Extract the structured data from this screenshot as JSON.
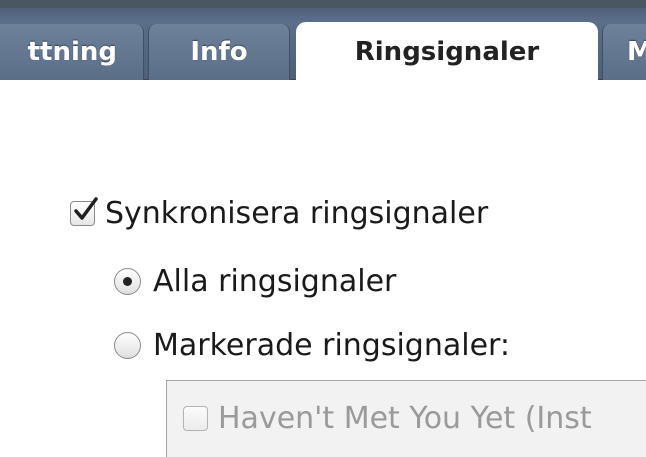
{
  "tabs": [
    {
      "label": "ttning",
      "active": false
    },
    {
      "label": "Info",
      "active": false
    },
    {
      "label": "Ringsignaler",
      "active": true
    },
    {
      "label": "M",
      "active": false
    }
  ],
  "ringtones": {
    "sync_label": "Synkronisera ringsignaler",
    "sync_checked": true,
    "all_label": "Alla ringsignaler",
    "all_selected": true,
    "selected_label": "Markerade ringsignaler:",
    "selected_selected": false,
    "list": [
      {
        "label": "Haven't Met You Yet (Inst",
        "checked": false
      }
    ]
  }
}
